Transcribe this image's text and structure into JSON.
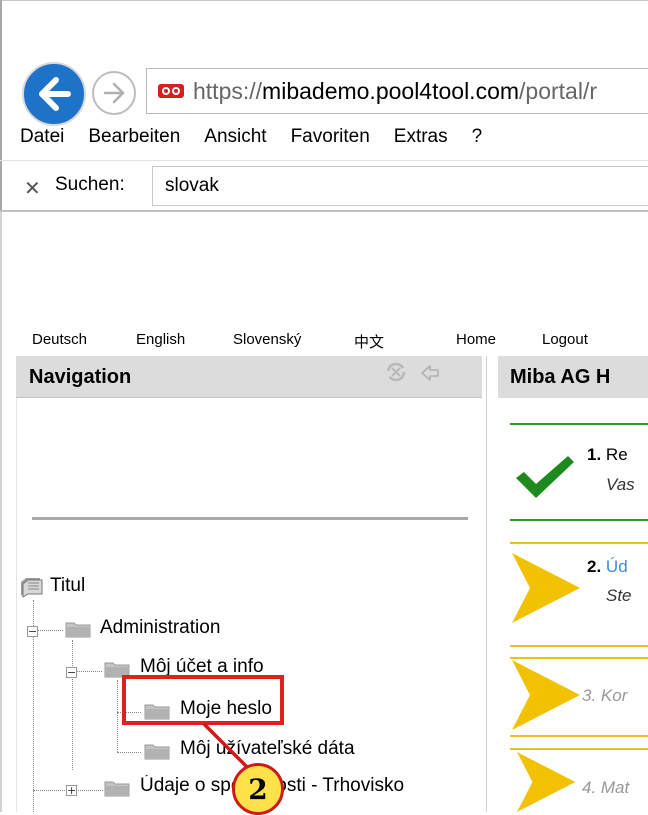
{
  "browser": {
    "url_prefix": "https://",
    "url_host": "mibademo.pool4tool.com",
    "url_path": "/portal/r",
    "menu": [
      "Datei",
      "Bearbeiten",
      "Ansicht",
      "Favoriten",
      "Extras",
      "?"
    ],
    "find_label": "Suchen:",
    "find_value": "slovak",
    "find_close": "✕"
  },
  "topnav": {
    "lang_de": "Deutsch",
    "lang_en": "English",
    "lang_sk": "Slovenský",
    "lang_zh": "中文",
    "home": "Home",
    "logout": "Logout"
  },
  "navigation": {
    "title": "Navigation",
    "tree": {
      "root": "Titul",
      "administration": "Administration",
      "account": "Môj účet a info",
      "password": "Moje heslo",
      "user_data": "Môj užívateľské dáta",
      "company": "Údaje o spoločnosti - Trhovisko"
    }
  },
  "callout_number": "2",
  "right_panel": {
    "title": "Miba AG H",
    "steps": [
      {
        "num": "1.",
        "label": "Re",
        "sub": "Vas"
      },
      {
        "num": "2.",
        "label": "Úd",
        "sub": "Ste"
      },
      {
        "label": "3. Kor"
      },
      {
        "label": "4. Mat"
      }
    ]
  },
  "colors": {
    "back_button": "#1e72c8",
    "highlight": "#e02020",
    "callout_fill": "#ffe24a",
    "check": "#1d8a1d",
    "arrow": "#f2c200"
  }
}
